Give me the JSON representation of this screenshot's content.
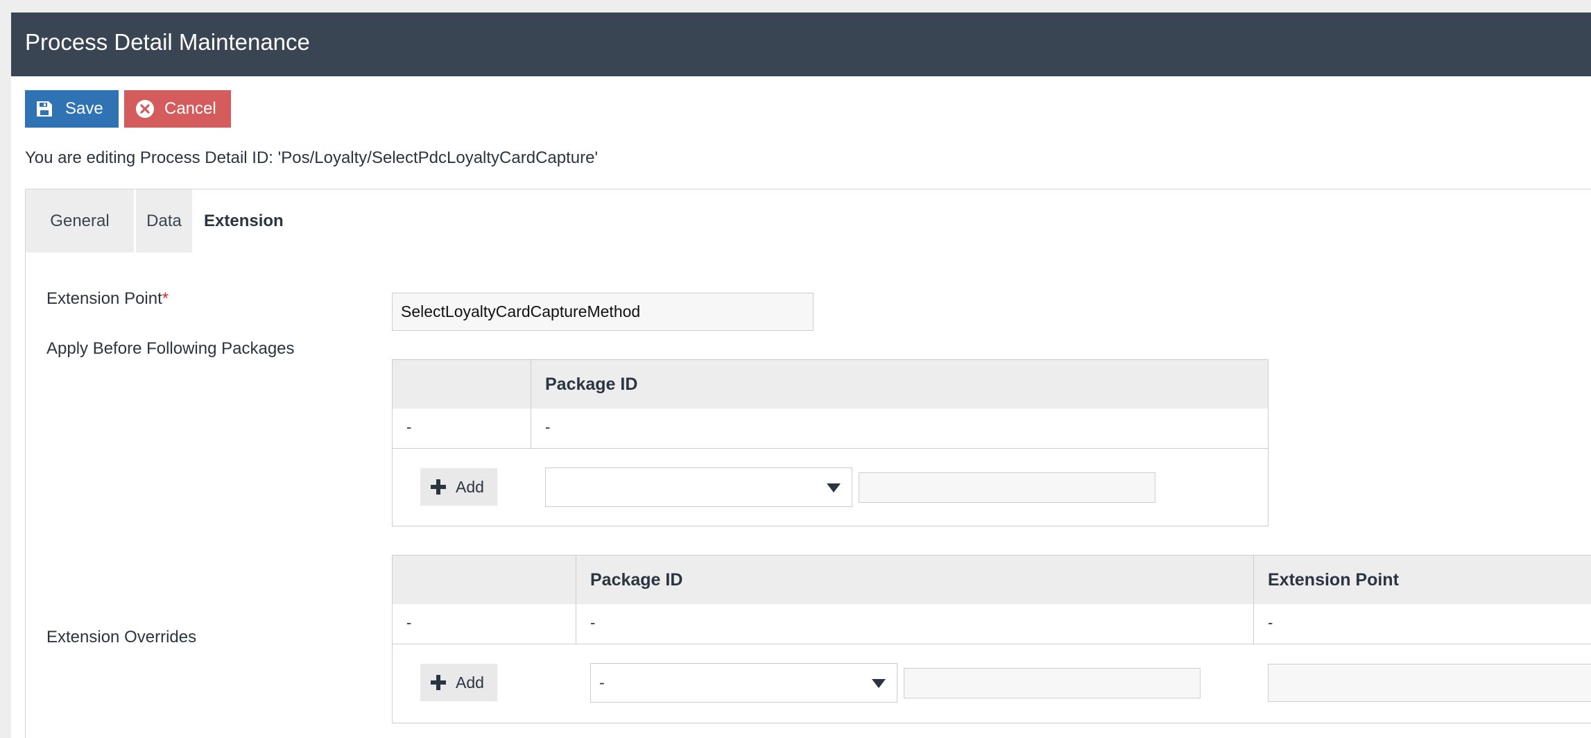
{
  "header": {
    "title": "Process Detail Maintenance"
  },
  "toolbar": {
    "save_label": "Save",
    "cancel_label": "Cancel"
  },
  "editing_text": "You are editing Process Detail ID: 'Pos/Loyalty/SelectPdcLoyaltyCardCapture'",
  "tabs": [
    {
      "label": "General",
      "active": false
    },
    {
      "label": "Data",
      "active": false
    },
    {
      "label": "Extension",
      "active": true
    }
  ],
  "form": {
    "extension_point": {
      "label": "Extension Point",
      "required_mark": "*",
      "value": "SelectLoyaltyCardCaptureMethod"
    },
    "apply_before": {
      "label": "Apply Before Following Packages",
      "columns": [
        "",
        "Package ID"
      ],
      "rows": [
        [
          "-",
          "-"
        ]
      ],
      "add_label": "Add",
      "select_value": "",
      "input_value": ""
    },
    "overrides": {
      "label": "Extension Overrides",
      "columns": [
        "",
        "Package ID",
        "Extension Point"
      ],
      "rows": [
        [
          "-",
          "-",
          "-"
        ]
      ],
      "add_label": "Add",
      "select_value": "-",
      "input_value": "",
      "ext_input_value": ""
    }
  },
  "icons": {
    "save": "floppy-disk-icon",
    "cancel": "circle-x-icon",
    "add": "plus-icon",
    "dropdown": "caret-down-icon"
  },
  "colors": {
    "header_bg": "#3a4553",
    "save_bg": "#2f73b5",
    "cancel_bg": "#d55c5c",
    "required": "#c9302c"
  }
}
